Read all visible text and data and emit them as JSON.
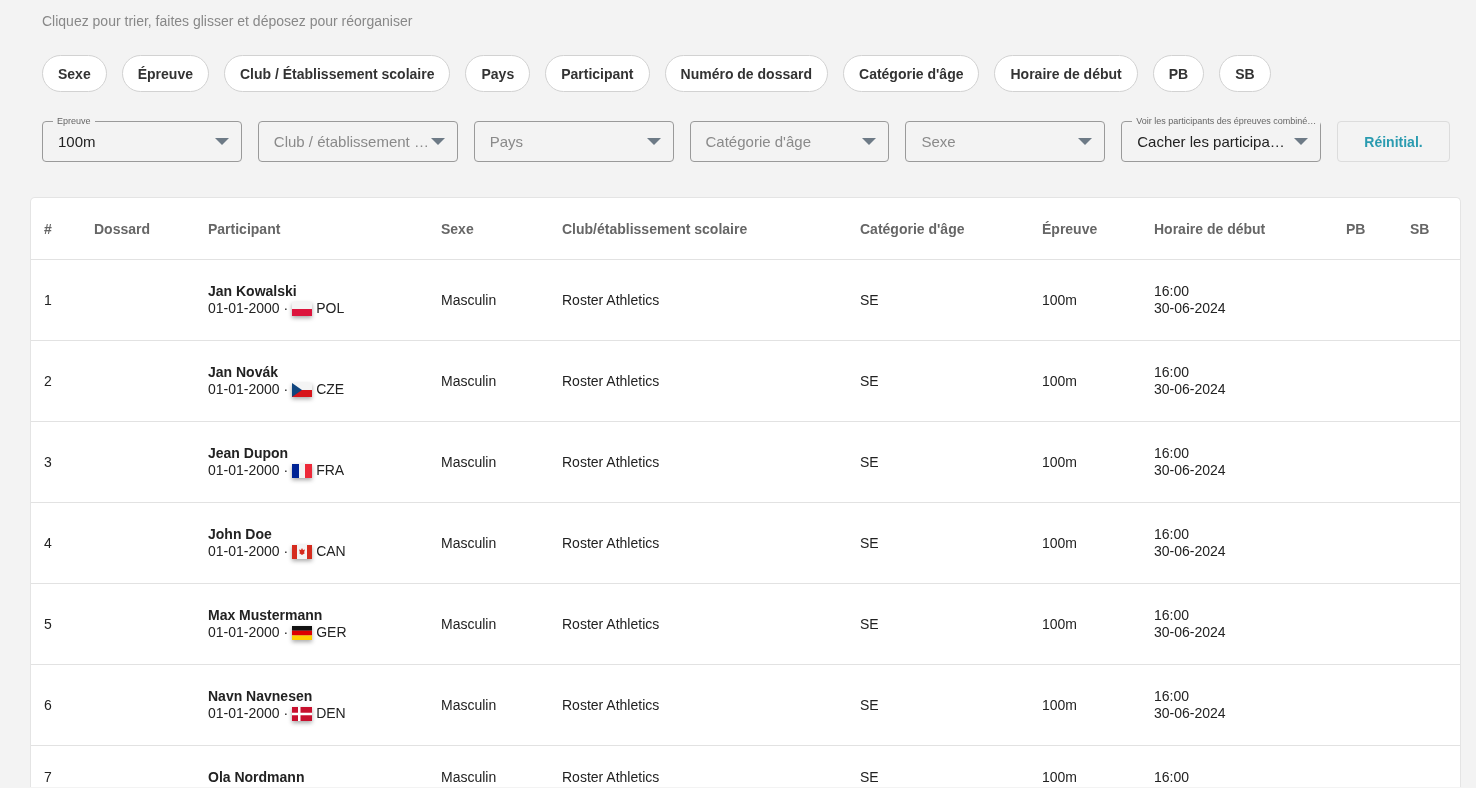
{
  "hint": "Cliquez pour trier, faites glisser et déposez pour réorganiser",
  "sort_chips": [
    "Sexe",
    "Épreuve",
    "Club / Établissement scolaire",
    "Pays",
    "Participant",
    "Numéro de dossard",
    "Catégorie d'âge",
    "Horaire de début",
    "PB",
    "SB"
  ],
  "filters": [
    {
      "label": "Epreuve",
      "value": "100m"
    },
    {
      "placeholder": "Club / établissement …"
    },
    {
      "placeholder": "Pays"
    },
    {
      "placeholder": "Catégorie d'âge"
    },
    {
      "placeholder": "Sexe"
    },
    {
      "label": "Voir les participants des épreuves combiné…",
      "value": "Cacher les participa…"
    }
  ],
  "reset_button": "Réinitial.",
  "table": {
    "columns": [
      "#",
      "Dossard",
      "Participant",
      "Sexe",
      "Club/établissement scolaire",
      "Catégorie d'âge",
      "Épreuve",
      "Horaire de début",
      "PB",
      "SB"
    ],
    "rows": [
      {
        "number": "1",
        "name": "Jan Kowalski",
        "birth_date": "01-01-2000 ·",
        "flag": {
          "kind": "pol"
        },
        "country": "POL",
        "sex": "Masculin",
        "club": "Roster Athletics",
        "category": "SE",
        "event": "100m",
        "time": "16:00",
        "date": "30-06-2024"
      },
      {
        "number": "2",
        "name": "Jan Novák",
        "birth_date": "01-01-2000 ·",
        "flag": {
          "kind": "cze"
        },
        "country": "CZE",
        "sex": "Masculin",
        "club": "Roster Athletics",
        "category": "SE",
        "event": "100m",
        "time": "16:00",
        "date": "30-06-2024"
      },
      {
        "number": "3",
        "name": "Jean Dupon",
        "birth_date": "01-01-2000 ·",
        "flag": {
          "kind": "fra"
        },
        "country": "FRA",
        "sex": "Masculin",
        "club": "Roster Athletics",
        "category": "SE",
        "event": "100m",
        "time": "16:00",
        "date": "30-06-2024"
      },
      {
        "number": "4",
        "name": "John Doe",
        "birth_date": "01-01-2000 ·",
        "flag": {
          "kind": "can"
        },
        "country": "CAN",
        "sex": "Masculin",
        "club": "Roster Athletics",
        "category": "SE",
        "event": "100m",
        "time": "16:00",
        "date": "30-06-2024"
      },
      {
        "number": "5",
        "name": "Max Mustermann",
        "birth_date": "01-01-2000 ·",
        "flag": {
          "kind": "ger"
        },
        "country": "GER",
        "sex": "Masculin",
        "club": "Roster Athletics",
        "category": "SE",
        "event": "100m",
        "time": "16:00",
        "date": "30-06-2024"
      },
      {
        "number": "6",
        "name": "Navn Navnesen",
        "birth_date": "01-01-2000 ·",
        "flag": {
          "kind": "den"
        },
        "country": "DEN",
        "sex": "Masculin",
        "club": "Roster Athletics",
        "category": "SE",
        "event": "100m",
        "time": "16:00",
        "date": "30-06-2024"
      },
      {
        "number": "7",
        "name": "Ola Nordmann",
        "sex": "Masculin",
        "club": "Roster Athletics",
        "category": "SE",
        "event": "100m",
        "time": "16:00"
      }
    ]
  }
}
